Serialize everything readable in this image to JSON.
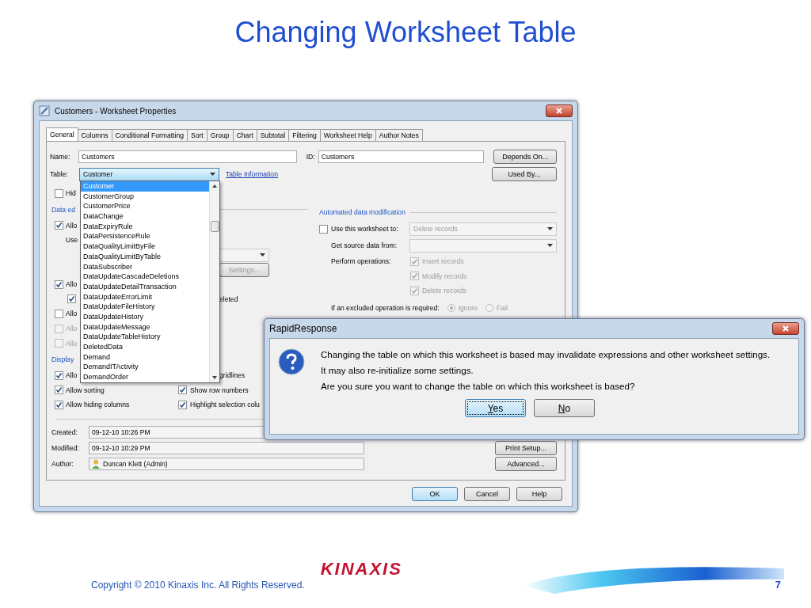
{
  "slide": {
    "title": "Changing Worksheet Table",
    "copyright": "Copyright © 2010 Kinaxis Inc. All Rights Reserved.",
    "logo": "KINAXIS",
    "page_number": "7"
  },
  "window": {
    "title": "Customers - Worksheet Properties"
  },
  "tabs": [
    {
      "label": "General",
      "selected": true
    },
    {
      "label": "Columns",
      "selected": false
    },
    {
      "label": "Conditional Formatting",
      "selected": false
    },
    {
      "label": "Sort",
      "selected": false
    },
    {
      "label": "Group",
      "selected": false
    },
    {
      "label": "Chart",
      "selected": false
    },
    {
      "label": "Subtotal",
      "selected": false
    },
    {
      "label": "Filtering",
      "selected": false
    },
    {
      "label": "Worksheet Help",
      "selected": false
    },
    {
      "label": "Author Notes",
      "selected": false
    }
  ],
  "name_field": {
    "label": "Name:",
    "value": "Customers"
  },
  "id_field": {
    "label": "ID:",
    "value": "Customers"
  },
  "table_field": {
    "label": "Table:",
    "value": "Customer",
    "link": "Table Information"
  },
  "side_buttons": [
    "Depends On...",
    "Used By..."
  ],
  "table_list": [
    {
      "label": "Customer",
      "selected": true
    },
    {
      "label": "CustomerGroup",
      "selected": false
    },
    {
      "label": "CustomerPrice",
      "selected": false
    },
    {
      "label": "DataChange",
      "selected": false
    },
    {
      "label": "DataExpiryRule",
      "selected": false
    },
    {
      "label": "DataPersistenceRule",
      "selected": false
    },
    {
      "label": "DataQualityLimitByFile",
      "selected": false
    },
    {
      "label": "DataQualityLimitByTable",
      "selected": false
    },
    {
      "label": "DataSubscriber",
      "selected": false
    },
    {
      "label": "DataUpdateCascadeDeletions",
      "selected": false
    },
    {
      "label": "DataUpdateDetailTransaction",
      "selected": false
    },
    {
      "label": "DataUpdateErrorLimit",
      "selected": false
    },
    {
      "label": "DataUpdateFileHistory",
      "selected": false
    },
    {
      "label": "DataUpdateHistory",
      "selected": false
    },
    {
      "label": "DataUpdateMessage",
      "selected": false
    },
    {
      "label": "DataUpdateTableHistory",
      "selected": false
    },
    {
      "label": "DeletedData",
      "selected": false
    },
    {
      "label": "Demand",
      "selected": false
    },
    {
      "label": "DemandITActivity",
      "selected": false
    },
    {
      "label": "DemandOrder",
      "selected": false
    }
  ],
  "left_rows": [
    {
      "left": {
        "kind": "check",
        "label": "Hid",
        "checked": false,
        "disabled": false
      }
    },
    {
      "left": {
        "kind": "section",
        "label": "Data ed"
      }
    },
    {
      "left": {
        "kind": "check",
        "label": "Allo",
        "checked": true,
        "disabled": false
      }
    },
    {
      "left": {
        "kind": "text",
        "label": "Use"
      }
    },
    {
      "right": {
        "kind": "combo"
      }
    },
    {
      "right": {
        "kind": "button",
        "label": "Settings..."
      }
    },
    {
      "left": {
        "kind": "check",
        "label": "Allo",
        "checked": true,
        "disabled": false
      }
    },
    {
      "left": {
        "kind": "subcheck",
        "checked": true,
        "disabled": false
      },
      "right": {
        "kind": "text",
        "label": "eleted"
      }
    },
    {
      "left": {
        "kind": "check",
        "label": "Allo",
        "checked": false,
        "disabled": false
      }
    },
    {
      "left": {
        "kind": "check",
        "label": "Allo",
        "checked": false,
        "disabled": true
      }
    },
    {
      "left": {
        "kind": "check",
        "label": "Allo",
        "checked": false,
        "disabled": true
      }
    },
    {
      "left": {
        "kind": "section",
        "label": "Display"
      }
    },
    {
      "left": {
        "kind": "check",
        "label": "Allo",
        "checked": true,
        "disabled": false
      },
      "right": {
        "kind": "text",
        "label": "gridlines"
      }
    },
    {
      "left": {
        "kind": "check",
        "label": "Allow sorting",
        "checked": true,
        "disabled": false
      },
      "right": {
        "kind": "check",
        "label": "Show row numbers",
        "checked": true,
        "disabled": false
      }
    },
    {
      "left": {
        "kind": "check",
        "label": "Allow hiding columns",
        "checked": true,
        "disabled": false
      },
      "right": {
        "kind": "check",
        "label": "Highlight selection colu",
        "checked": true,
        "disabled": false
      }
    }
  ],
  "automated": {
    "title": "Automated data modification",
    "use_label": "Use this worksheet to:",
    "use_checked": false,
    "use_value": "Delete records",
    "source_label": "Get source data from:",
    "operations_label": "Perform operations:",
    "operations": [
      {
        "label": "Insert records",
        "checked": true
      },
      {
        "label": "Modify records",
        "checked": true
      },
      {
        "label": "Delete records",
        "checked": true
      }
    ],
    "excluded_label": "If an excluded operation is required:",
    "excluded_options": [
      {
        "label": "Ignore",
        "selected": true
      },
      {
        "label": "Fail",
        "selected": false
      }
    ]
  },
  "meta": [
    {
      "label": "Created:",
      "value": "09-12-10 10:26 PM",
      "kind": "text"
    },
    {
      "label": "Modified:",
      "value": "09-12-10 10:29 PM",
      "kind": "text"
    },
    {
      "label": "Author:",
      "value": "Duncan Klett (Admin)",
      "kind": "user"
    }
  ],
  "right_buttons": [
    "Print Setup...",
    "Advanced..."
  ],
  "footer_buttons": [
    {
      "label": "OK",
      "default": true
    },
    {
      "label": "Cancel",
      "default": false
    },
    {
      "label": "Help",
      "default": false
    }
  ],
  "dialog": {
    "title": "RapidResponse",
    "message": [
      "Changing the table on which this worksheet is based may invalidate expressions and other worksheet settings. It may also re-initialize some settings.",
      "Are you sure you want to change the table on which this worksheet is based?"
    ],
    "buttons": [
      {
        "label": "Yes",
        "default": true
      },
      {
        "label": "No",
        "default": false
      }
    ]
  }
}
